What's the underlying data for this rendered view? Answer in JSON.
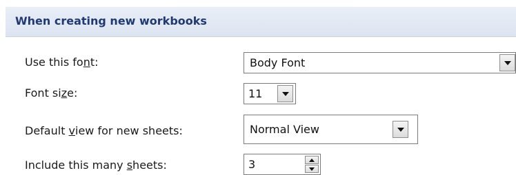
{
  "section": {
    "title": "When creating new workbooks"
  },
  "rows": [
    {
      "label_pre": "Use this fo",
      "label_hot": "n",
      "label_post": "t:",
      "value": "Body Font"
    },
    {
      "label_pre": "Font si",
      "label_hot": "z",
      "label_post": "e:",
      "value": "11"
    },
    {
      "label_pre": "Default ",
      "label_hot": "v",
      "label_post": "iew for new sheets:",
      "value": "Normal View"
    },
    {
      "label_pre": "Include this many ",
      "label_hot": "s",
      "label_post": "heets:",
      "value": "3"
    }
  ],
  "icons": {
    "dropdown": "chevron-down-icon",
    "spin_up": "spin-up-icon",
    "spin_down": "spin-down-icon"
  }
}
